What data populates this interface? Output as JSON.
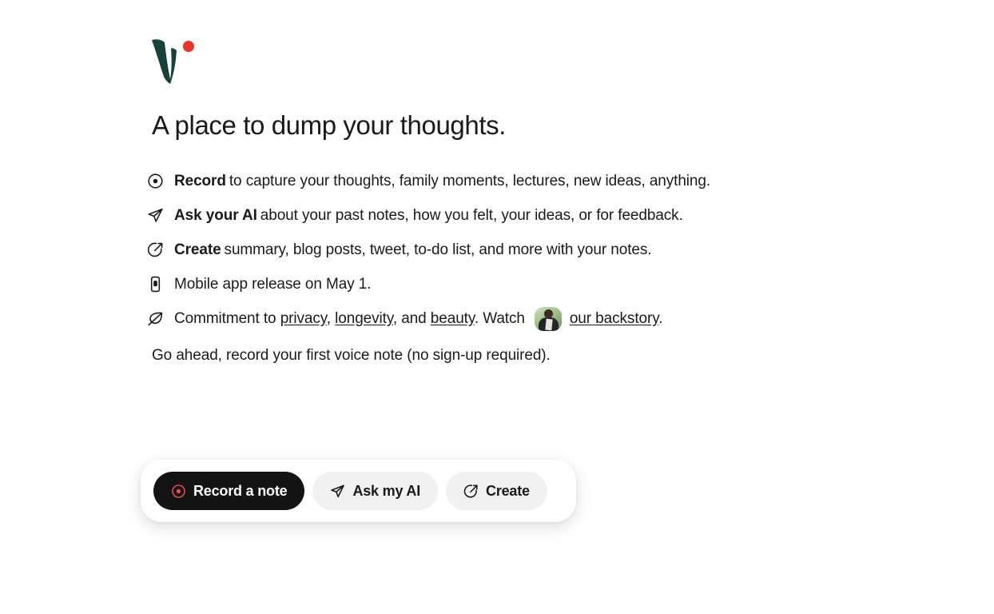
{
  "brand": {
    "logo_name": "voicenotes-v-logo",
    "logo_mark_color": "#15433a",
    "logo_dot_color": "#e8342a"
  },
  "headline": "A place to dump your thoughts.",
  "features": [
    {
      "icon": "record-circle-icon",
      "lead": "Record",
      "lead_bold": true,
      "rest": "to capture your thoughts, family moments, lectures, new ideas, anything."
    },
    {
      "icon": "paper-plane-icon",
      "lead": "Ask your AI",
      "lead_bold": true,
      "rest": "about your past notes, how you felt, your ideas, or for feedback."
    },
    {
      "icon": "edit-circle-icon",
      "lead": "Create",
      "lead_bold": true,
      "rest": "summary, blog posts, tweet, to-do list, and more with your notes."
    },
    {
      "icon": "mobile-phone-icon",
      "lead": "",
      "lead_bold": false,
      "rest": "Mobile app release on May 1."
    }
  ],
  "commitment": {
    "icon": "leaf-icon",
    "prefix": "Commitment to",
    "link_privacy": "privacy",
    "comma_1": ",",
    "link_longevity": "longevity",
    "comma_2": ", and",
    "link_beauty": "beauty",
    "watch_text": ". Watch",
    "avatar_name": "founder-avatar",
    "link_backstory": "our backstory",
    "period": "."
  },
  "closing": "Go ahead, record your first voice note (no sign-up required).",
  "cta": {
    "record_label": "Record a note",
    "record_icon": "record-circle-icon",
    "record_icon_color": "#e5484d",
    "record_bg": "#141414",
    "ask_label": "Ask my AI",
    "ask_icon": "paper-plane-icon",
    "create_label": "Create",
    "create_icon": "edit-circle-icon",
    "secondary_bg": "#f1f1f1"
  }
}
